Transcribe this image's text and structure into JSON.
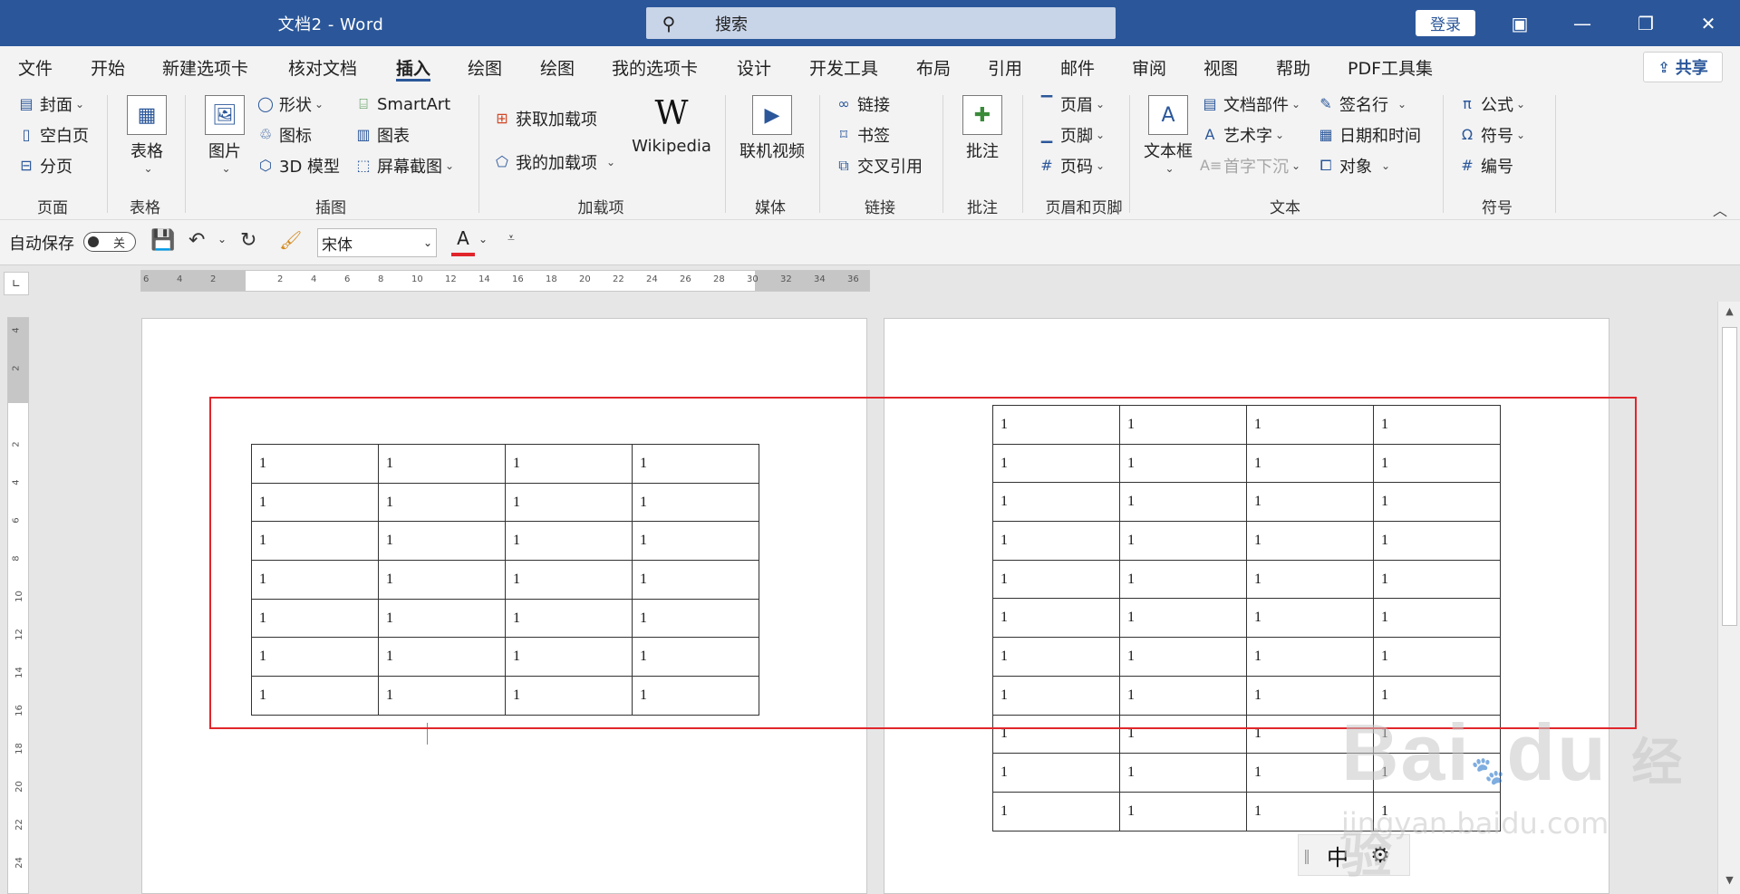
{
  "title_bar": {
    "doc_title": "文档2  -  Word",
    "search_placeholder": "搜索",
    "login": "登录",
    "controls": [
      "ribbon-display-icon",
      "minimize-icon",
      "restore-icon",
      "close-icon"
    ]
  },
  "menu": {
    "tabs": [
      "文件",
      "开始",
      "新建选项卡",
      "核对文档",
      "插入",
      "绘图",
      "绘图",
      "我的选项卡",
      "设计",
      "开发工具",
      "布局",
      "引用",
      "邮件",
      "审阅",
      "视图",
      "帮助",
      "PDF工具集"
    ],
    "active_tab": "插入",
    "share": "共享"
  },
  "ribbon": {
    "page": {
      "label": "页面",
      "items": [
        "封面",
        "空白页",
        "分页"
      ]
    },
    "table": {
      "label": "表格",
      "button": "表格"
    },
    "illustrations": {
      "label": "插图",
      "picture": "图片",
      "items_col1": [
        "形状",
        "图标",
        "3D 模型"
      ],
      "items_col2": [
        "SmartArt",
        "图表",
        "屏幕截图"
      ]
    },
    "addins": {
      "label": "加载项",
      "get": "获取加载项",
      "mine": "我的加载项",
      "wiki_logo": "W",
      "wiki": "Wikipedia"
    },
    "media": {
      "label": "媒体",
      "button": "联机视频"
    },
    "links": {
      "label": "链接",
      "items": [
        "链接",
        "书签",
        "交叉引用"
      ]
    },
    "comments": {
      "label": "批注",
      "button": "批注"
    },
    "header_footer": {
      "label": "页眉和页脚",
      "items": [
        "页眉",
        "页脚",
        "页码"
      ]
    },
    "text": {
      "label": "文本",
      "textbox": "文本框",
      "items_col1": [
        "文档部件",
        "艺术字",
        "首字下沉"
      ],
      "items_col2": [
        "签名行",
        "日期和时间",
        "对象"
      ]
    },
    "symbols": {
      "label": "符号",
      "items": [
        "公式",
        "符号",
        "编号"
      ]
    }
  },
  "qat": {
    "autosave_label": "自动保存",
    "autosave_state": "关",
    "font_name": "宋体",
    "font_color_letter": "A"
  },
  "ruler_h_ticks": [
    "6",
    "4",
    "2",
    "",
    "2",
    "4",
    "6",
    "8",
    "10",
    "12",
    "14",
    "16",
    "18",
    "20",
    "22",
    "24",
    "26",
    "28",
    "30",
    "32",
    "34",
    "36"
  ],
  "ruler_v_ticks": [
    "4",
    "2",
    "",
    "2",
    "4",
    "6",
    "8",
    "10",
    "12",
    "14",
    "16",
    "18",
    "20",
    "22",
    "24"
  ],
  "page1_table": {
    "rows": 7,
    "cols": 4,
    "cell": "1"
  },
  "page2_table": {
    "rows": 11,
    "cols": 4,
    "cell": "1"
  },
  "ime": {
    "mode": "中"
  },
  "watermark": {
    "brand": "Bai",
    "brand2": "du",
    "cn": "经验",
    "url": "jingyan.baidu.com"
  },
  "colors": {
    "accent": "#2b579a",
    "highlight_box": "#e0262b"
  }
}
